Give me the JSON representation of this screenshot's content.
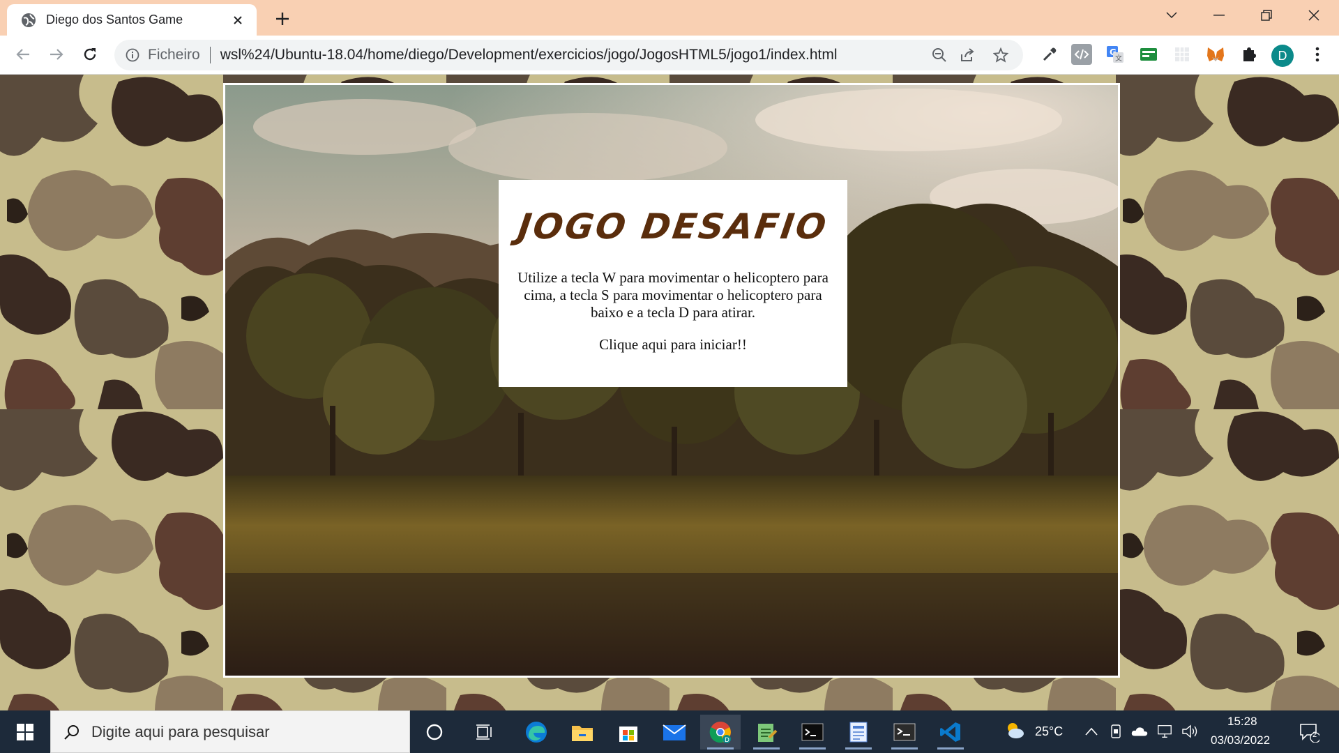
{
  "browser": {
    "tab_title": "Diego dos Santos Game",
    "site_info_label": "Ficheiro",
    "url": "wsl%24/Ubuntu-18.04/home/diego/Development/exercicios/jogo/JogosHTML5/jogo1/index.html",
    "profile_initial": "D"
  },
  "game": {
    "title": "JOGO DESAFIO",
    "instructions": "Utilize a tecla W para movimentar o helicoptero para cima, a tecla S para movimentar o helicoptero para baixo e a tecla D para atirar.",
    "start_label": "Clique aqui para iniciar!!"
  },
  "taskbar": {
    "search_placeholder": "Digite aqui para pesquisar",
    "temperature": "25°C",
    "time": "15:28",
    "date": "03/03/2022",
    "notification_count": "2"
  },
  "colors": {
    "tabbar_bg": "#f9d0b3",
    "taskbar_bg": "#1d2a3a",
    "title_brown": "#5a2d0c",
    "profile_teal": "#0b8a8a"
  },
  "icons": {
    "tab": [
      "globe-icon",
      "close-icon",
      "plus-icon"
    ],
    "window": [
      "chevron-down-icon",
      "minimize-icon",
      "restore-icon",
      "close-icon"
    ],
    "toolbar": [
      "back-icon",
      "forward-icon",
      "reload-icon",
      "info-icon",
      "zoom-out-icon",
      "share-icon",
      "star-icon"
    ],
    "extensions": [
      "eyedropper-icon",
      "code-icon",
      "translate-icon",
      "bill-icon",
      "grid-icon",
      "metamask-icon",
      "puzzle-icon",
      "menu-dots-icon"
    ],
    "taskbar": [
      "windows-start-icon",
      "search-icon",
      "cortana-icon",
      "task-view-icon",
      "edge-icon",
      "file-explorer-icon",
      "store-icon",
      "mail-icon",
      "chrome-icon",
      "notepad-icon",
      "terminal-icon",
      "document-icon",
      "console-icon",
      "vscode-icon"
    ],
    "tray": [
      "weather-icon",
      "chevron-up-icon",
      "device-icon",
      "onedrive-icon",
      "network-icon",
      "volume-icon",
      "notification-icon"
    ]
  }
}
